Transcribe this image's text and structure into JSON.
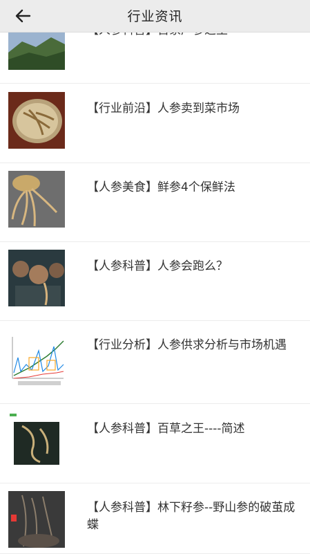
{
  "header": {
    "title": "行业资讯",
    "back_icon": "arrow-left-icon"
  },
  "articles": [
    {
      "title": "【人参科普】百家产参之王"
    },
    {
      "title": "【行业前沿】人参卖到菜市场"
    },
    {
      "title": "【人参美食】鲜参4个保鲜法"
    },
    {
      "title": "【人参科普】人参会跑么？"
    },
    {
      "title": "【行业分析】人参供求分析与市场机遇"
    },
    {
      "title": "【人参科普】百草之王----简述"
    },
    {
      "title": "【人参科普】林下籽参--野山参的破茧成蝶"
    }
  ],
  "colors": {
    "header_bg": "#ececec",
    "divider": "#ececec",
    "text": "#333333"
  }
}
